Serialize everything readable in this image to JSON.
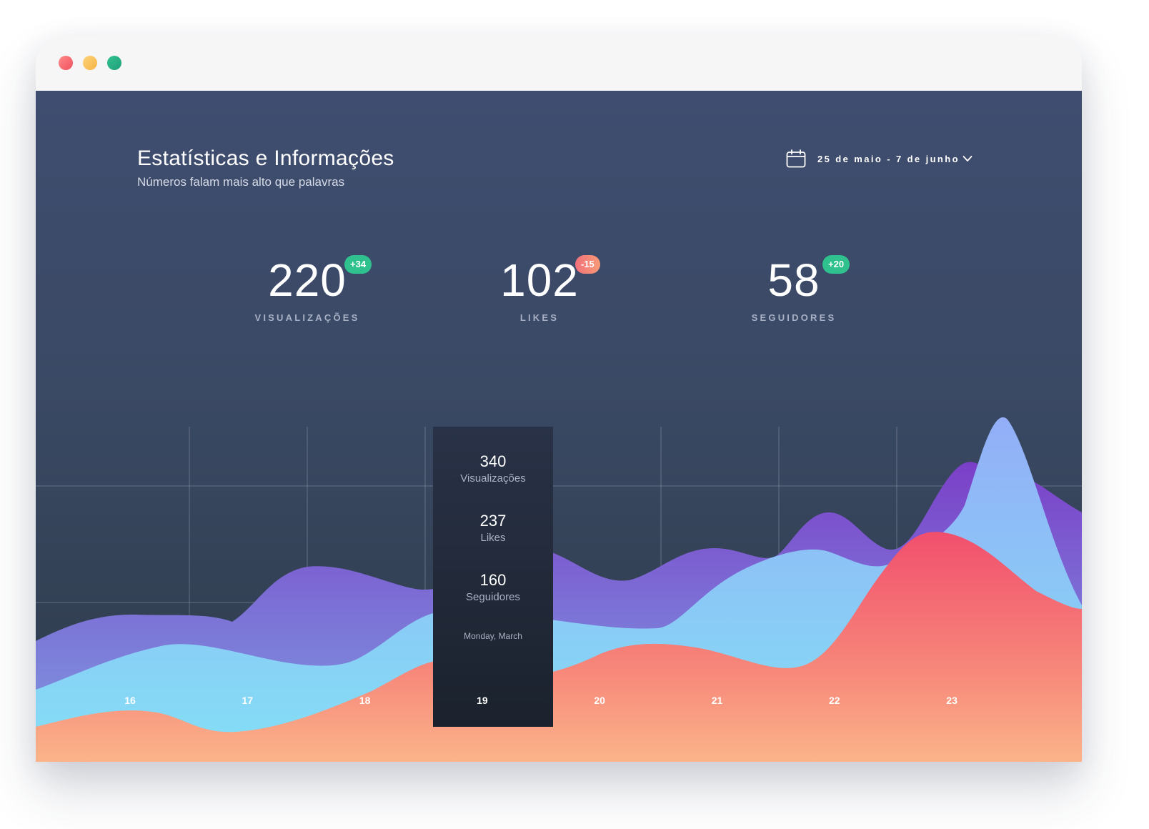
{
  "window": {
    "controls": [
      "close",
      "minimize",
      "maximize"
    ]
  },
  "header": {
    "title": "Estatísticas e Informações",
    "subtitle": "Números falam mais alto que palavras"
  },
  "date_range": {
    "label": "25 de maio - 7 de junho",
    "icon": "calendar-icon",
    "dropdown_icon": "chevron-down-icon"
  },
  "stats": [
    {
      "value": "220",
      "label": "VISUALIZAÇÕES",
      "change": "+34",
      "trend": "up"
    },
    {
      "value": "102",
      "label": "LIKES",
      "change": "-15",
      "trend": "down"
    },
    {
      "value": "58",
      "label": "SEGUIDORES",
      "change": "+20",
      "trend": "up"
    }
  ],
  "tooltip": {
    "views": "340",
    "views_label": "Visualizações",
    "likes": "237",
    "likes_label": "Likes",
    "followers": "160",
    "followers_label": "Seguidores",
    "date": "Monday, March"
  },
  "chart_data": {
    "type": "area",
    "x": [
      "16",
      "17",
      "18",
      "19",
      "20",
      "21",
      "22",
      "23"
    ],
    "selected": "19",
    "series": [
      {
        "values": [
          0.35,
          0.33,
          0.47,
          0.44,
          0.48,
          0.55,
          0.63,
          0.86
        ]
      },
      {
        "values": [
          0.24,
          0.21,
          0.15,
          0.31,
          0.32,
          0.37,
          0.52,
          0.64
        ]
      },
      {
        "values": [
          0.07,
          0.03,
          0.1,
          0.22,
          0.21,
          0.25,
          0.26,
          0.62
        ]
      }
    ],
    "colors": {
      "purple": [
        "#7c4fd0",
        "#7e8bdc"
      ],
      "blue": [
        "#8fb3f6",
        "#86dcf5"
      ],
      "red": [
        "#f2566f",
        "#fbb08a"
      ]
    },
    "grid": true
  }
}
